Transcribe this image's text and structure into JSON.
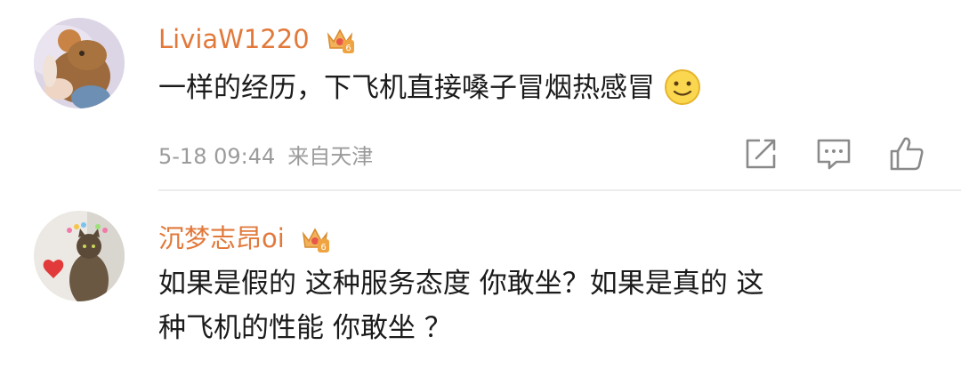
{
  "comments": [
    {
      "username": "LiviaW1220",
      "badge_icon": "vip-crown-icon",
      "text": "一样的经历，下飞机直接嗓子冒烟热感冒",
      "emoji": "smiley-face-icon",
      "date": "5-18 09:44",
      "location": "来自天津",
      "actions": [
        "share-icon",
        "comment-icon",
        "like-icon"
      ]
    },
    {
      "username": "沉梦志昂oi",
      "badge_icon": "vip-crown-icon",
      "text_lines": [
        "如果是假的 这种服务态度 你敢坐？如果是真的 这",
        "种飞机的性能 你敢坐 ？"
      ]
    }
  ],
  "colors": {
    "username": "#e2793b",
    "text": "#1b1b1b",
    "meta": "#9b9b9b",
    "icon": "#8a8a8a"
  }
}
